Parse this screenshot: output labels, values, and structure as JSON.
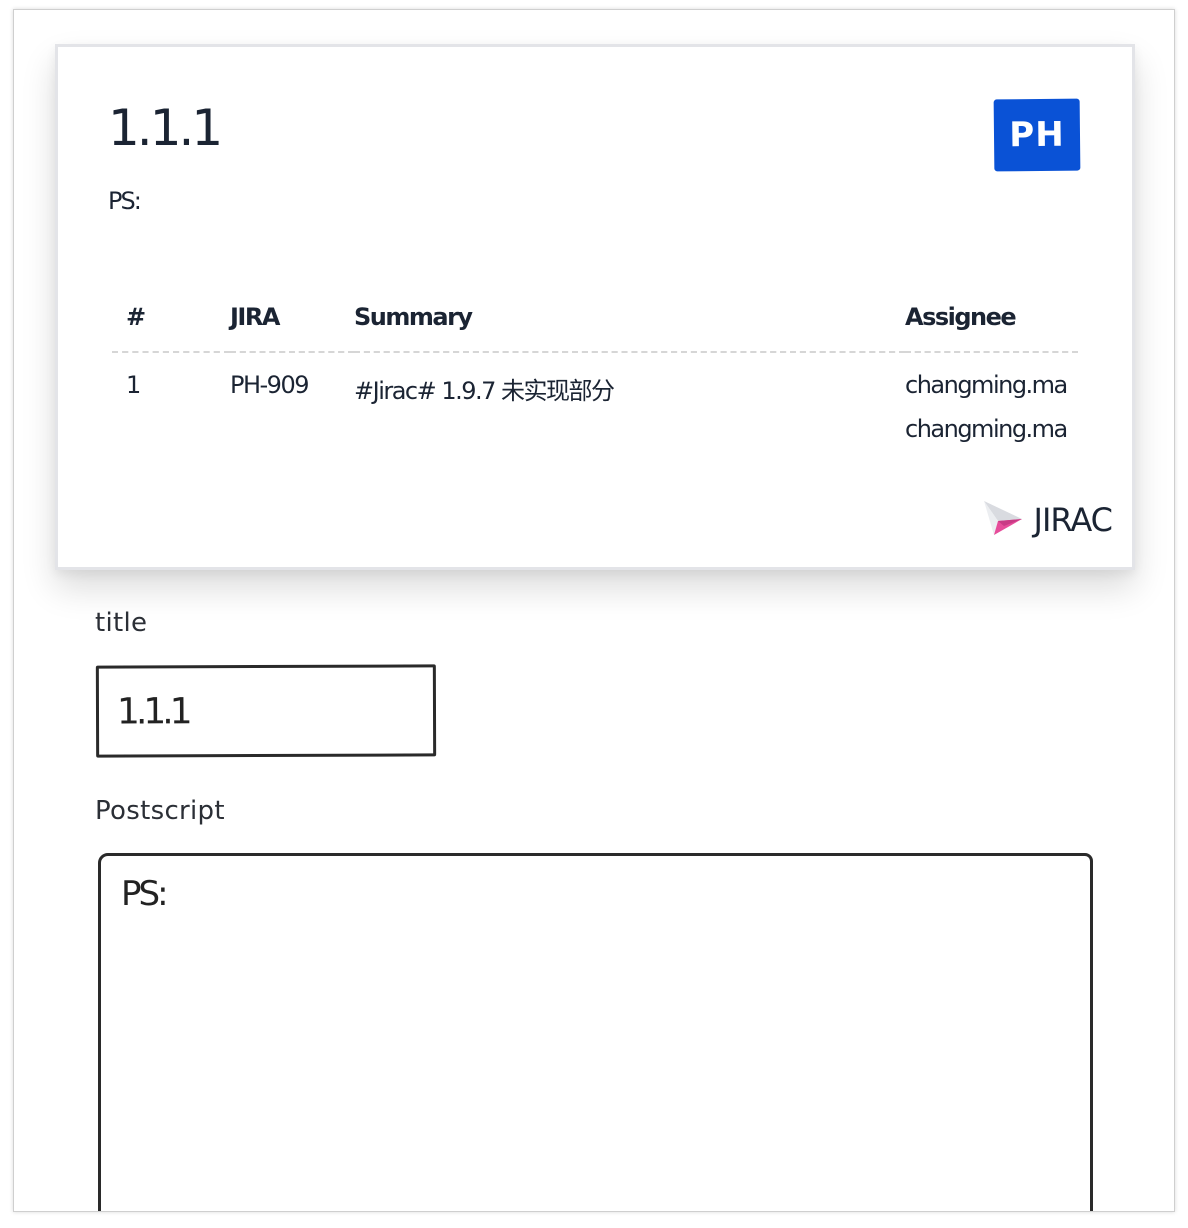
{
  "card": {
    "title": "1.1.1",
    "postscript": "PS:",
    "project_badge": "PH",
    "table": {
      "headers": [
        "#",
        "JIRA",
        "Summary",
        "Assignee"
      ],
      "rows": [
        {
          "num": "1",
          "jira": "PH-909",
          "summary": "#Jirac# 1.9.7 未实现部分",
          "assignees": [
            "changming.ma",
            "changming.ma"
          ]
        }
      ]
    },
    "brand": "JIRAC"
  },
  "form": {
    "title_label": "title",
    "title_value": "1.1.1",
    "postscript_label": "Postscript",
    "postscript_value": "PS:"
  },
  "colors": {
    "badge_blue": "#0a52d6",
    "text_dark": "#1b2433",
    "logo_pink": "#e64c9a"
  },
  "icons": {
    "brand_logo": "paper-plane-icon"
  }
}
